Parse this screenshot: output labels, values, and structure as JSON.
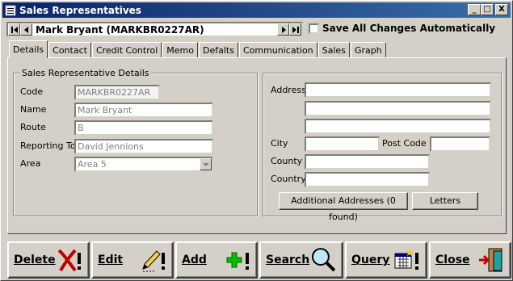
{
  "window": {
    "title": "Sales Representatives",
    "min": "_",
    "max": "□",
    "close": "X"
  },
  "nav": {
    "record": "Mark Bryant (MARKBR0227AR)"
  },
  "save_all": {
    "label": "Save All Changes Automatically",
    "checked": false
  },
  "tabs": [
    "Details",
    "Contact",
    "Credit Control",
    "Memo",
    "Defalts",
    "Communication",
    "Sales",
    "Graph"
  ],
  "details": {
    "group_title": "Sales Representative Details",
    "code_label": "Code",
    "code_value": "MARKBR0227AR",
    "name_label": "Name",
    "name_value": "Mark Bryant",
    "route_label": "Route",
    "route_value": "B",
    "reporting_label": "Reporting To",
    "reporting_value": "David Jennions",
    "area_label": "Area",
    "area_value": "Area 5"
  },
  "address": {
    "address_label": "Address",
    "address_line1": "",
    "address_line2": "",
    "address_line3": "",
    "city_label": "City",
    "city_value": "",
    "postcode_label": "Post Code",
    "postcode_value": "",
    "county_label": "County",
    "county_value": "",
    "country_label": "Country",
    "country_value": "",
    "additional_btn": "Additional Addresses (0 found)",
    "letters_btn": "Letters"
  },
  "actions": {
    "delete": "Delete",
    "edit": "Edit",
    "add": "Add",
    "search": "Search",
    "query": "Query",
    "close": "Close"
  }
}
